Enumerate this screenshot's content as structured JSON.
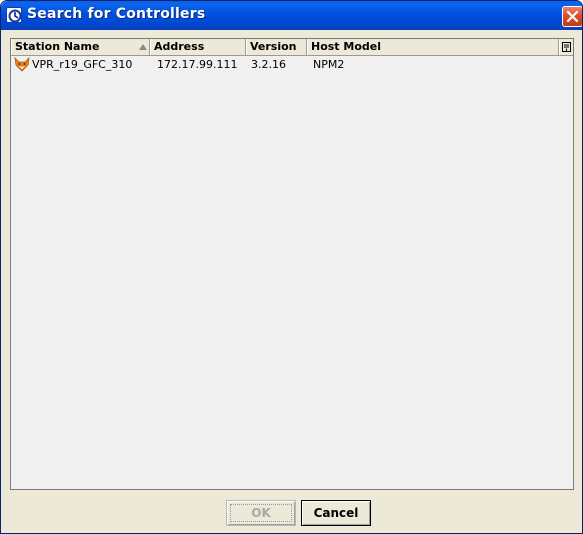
{
  "window": {
    "title": "Search for Controllers"
  },
  "table": {
    "columns": [
      {
        "label": "Station Name",
        "sorted": "ascending"
      },
      {
        "label": "Address"
      },
      {
        "label": "Version"
      },
      {
        "label": "Host Model"
      }
    ],
    "rows": [
      {
        "icon": "fox-icon",
        "station_name": "VPR_r19_GFC_310",
        "address": "172.17.99.111",
        "version": "3.2.16",
        "host_model": "NPM2"
      }
    ]
  },
  "buttons": {
    "ok_label": "OK",
    "ok_enabled": false,
    "cancel_label": "Cancel"
  },
  "colors": {
    "titlebar": "#0050dd",
    "window_bg": "#ece9d8",
    "close_button": "#d9502e"
  }
}
